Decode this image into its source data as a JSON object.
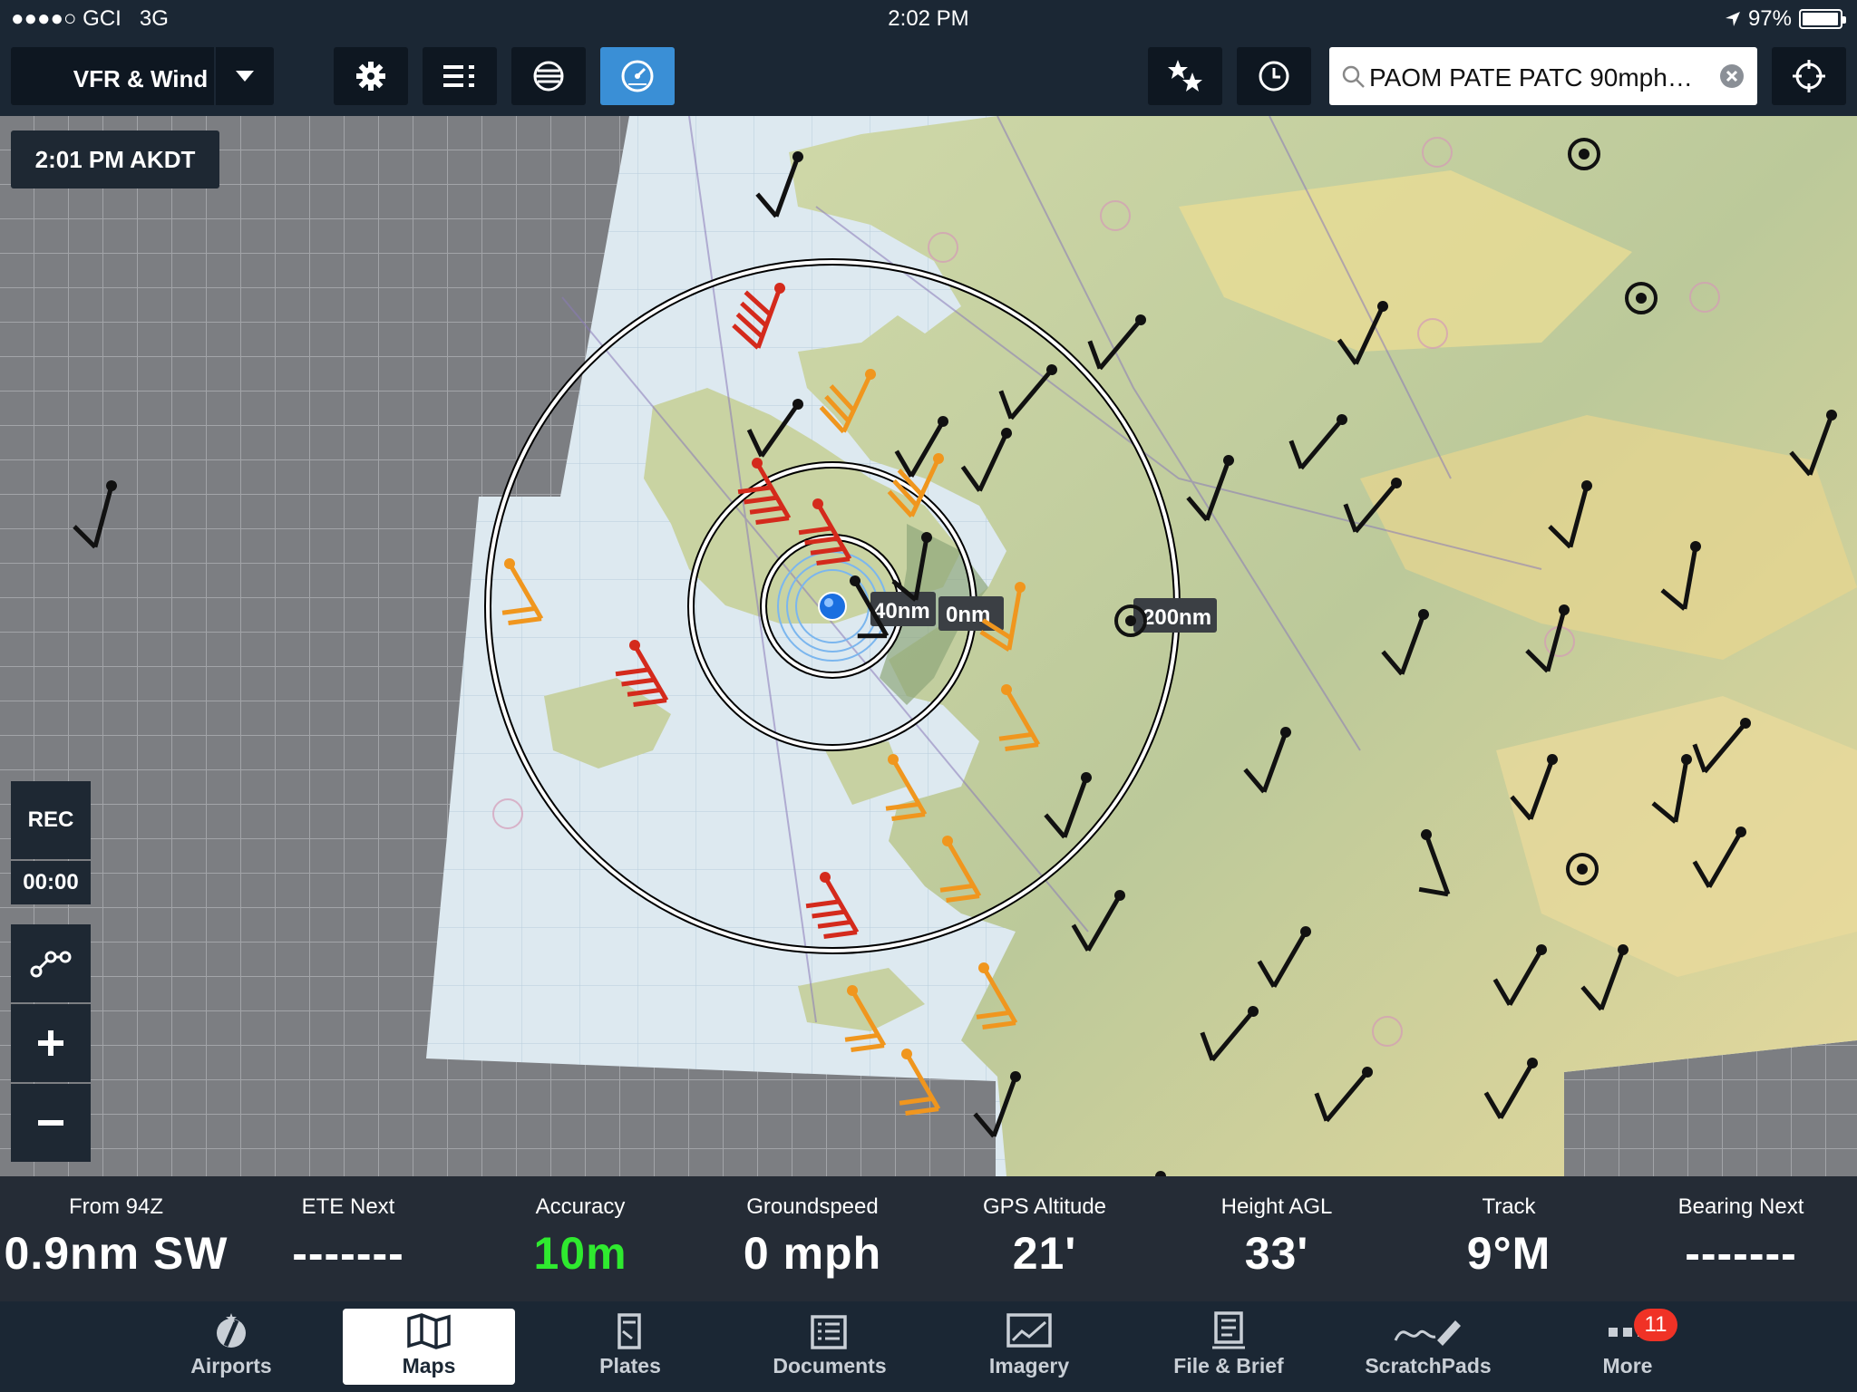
{
  "status": {
    "carrier": "GCI",
    "network": "3G",
    "time": "2:02 PM",
    "battery_pct": "97%",
    "battery_level": 0.97
  },
  "toolbar": {
    "layer": "VFR & Wind",
    "search_text": "PAOM PATE PATC 90mph…",
    "icons": [
      "gear-icon",
      "list-icon",
      "layers-globe-icon",
      "gauge-icon",
      "favorites-icon",
      "clock-icon",
      "locate-icon"
    ]
  },
  "map": {
    "time_chip": "2:01 PM AKDT",
    "rec_label": "REC",
    "rec_timer": "00:00",
    "range_labels": {
      "r40": "40nm",
      "r100": "0nm",
      "r200": "200nm"
    }
  },
  "instruments": [
    {
      "label": "From 94Z",
      "value": "0.9nm SW",
      "color": "#ffffff"
    },
    {
      "label": "ETE Next",
      "value": "-------",
      "color": "#ffffff"
    },
    {
      "label": "Accuracy",
      "value": "10m",
      "color": "#2fea2f"
    },
    {
      "label": "Groundspeed",
      "value": "0 mph",
      "color": "#ffffff"
    },
    {
      "label": "GPS Altitude",
      "value": "21'",
      "color": "#ffffff"
    },
    {
      "label": "Height AGL",
      "value": "33'",
      "color": "#ffffff"
    },
    {
      "label": "Track",
      "value": "9°M",
      "color": "#ffffff"
    },
    {
      "label": "Bearing Next",
      "value": "-------",
      "color": "#ffffff"
    }
  ],
  "tabs": [
    {
      "label": "Airports",
      "icon": "airports-icon"
    },
    {
      "label": "Maps",
      "icon": "maps-icon",
      "active": true
    },
    {
      "label": "Plates",
      "icon": "plates-icon"
    },
    {
      "label": "Documents",
      "icon": "documents-icon"
    },
    {
      "label": "Imagery",
      "icon": "imagery-icon"
    },
    {
      "label": "File & Brief",
      "icon": "file-brief-icon"
    },
    {
      "label": "ScratchPads",
      "icon": "scratchpads-icon"
    },
    {
      "label": "More",
      "icon": "more-icon",
      "badge": "11"
    }
  ],
  "colors": {
    "accent": "#3a8fd6",
    "bar": "#1b2734",
    "wind_high": "#d42a1c",
    "wind_mid": "#f0961e",
    "wind_low": "#111111"
  }
}
